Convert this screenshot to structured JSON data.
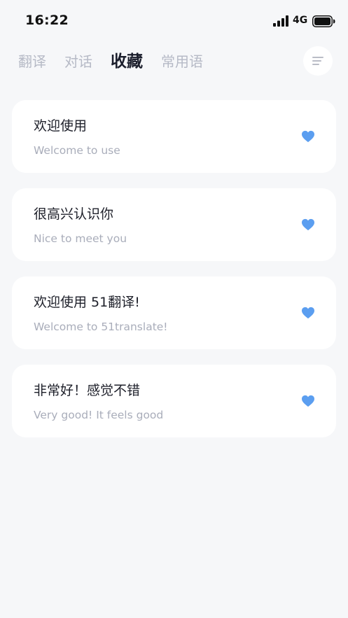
{
  "status_bar": {
    "time": "16:22",
    "network": "4G",
    "signal_icon": "signal-bars-icon",
    "battery_icon": "battery-icon"
  },
  "tabs": [
    {
      "label": "翻译",
      "active": false
    },
    {
      "label": "对话",
      "active": false
    },
    {
      "label": "收藏",
      "active": true
    },
    {
      "label": "常用语",
      "active": false
    }
  ],
  "menu_button": {
    "icon": "menu-lines-icon"
  },
  "colors": {
    "background": "#f6f7f9",
    "card": "#ffffff",
    "accent_heart": "#5b9ef0",
    "active_tab": "#1b1e2c",
    "inactive_tab": "#b6bac6",
    "subtitle": "#a9adba"
  },
  "favorites": [
    {
      "title": "欢迎使用",
      "translation": "Welcome to use",
      "icon": "heart-filled-icon"
    },
    {
      "title": "很高兴认识你",
      "translation": "Nice to meet you",
      "icon": "heart-filled-icon"
    },
    {
      "title": "欢迎使用 51翻译!",
      "translation": "Welcome to 51translate!",
      "icon": "heart-filled-icon"
    },
    {
      "title": "非常好！感觉不错",
      "translation": "Very good! It feels good",
      "icon": "heart-filled-icon"
    }
  ]
}
